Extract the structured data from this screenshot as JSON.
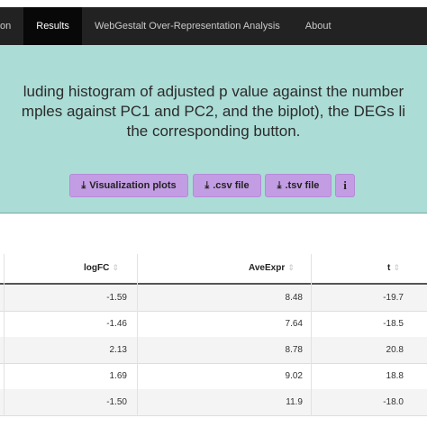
{
  "navbar": {
    "items": [
      {
        "label": "on",
        "active": false
      },
      {
        "label": "Results",
        "active": true
      },
      {
        "label": "WebGestalt Over-Representation Analysis",
        "active": false
      },
      {
        "label": "About",
        "active": false
      }
    ]
  },
  "banner": {
    "line1": "luding histogram of adjusted p value against the number",
    "line2": "mples against PC1 and PC2, and the biplot), the DEGs li",
    "line3": "the corresponding button.",
    "background": "#abdcd6"
  },
  "buttons": {
    "visualization_label": "Visualization plots",
    "csv_label": ".csv file",
    "tsv_label": ".tsv file",
    "info_label": "i",
    "icon": "download-icon",
    "color": "#c39de3"
  },
  "table": {
    "headers": {
      "logfc": "logFC",
      "aveexpr": "AveExpr",
      "t": "t"
    },
    "sort_icon": "⇕",
    "rows": [
      {
        "logfc": "-1.59",
        "aveexpr": "8.48",
        "t": "-19.7"
      },
      {
        "logfc": "-1.46",
        "aveexpr": "7.64",
        "t": "-18.5"
      },
      {
        "logfc": "2.13",
        "aveexpr": "8.78",
        "t": "20.8"
      },
      {
        "logfc": "1.69",
        "aveexpr": "9.02",
        "t": "18.8"
      },
      {
        "logfc": "-1.50",
        "aveexpr": "11.9",
        "t": "-18.0"
      }
    ]
  }
}
